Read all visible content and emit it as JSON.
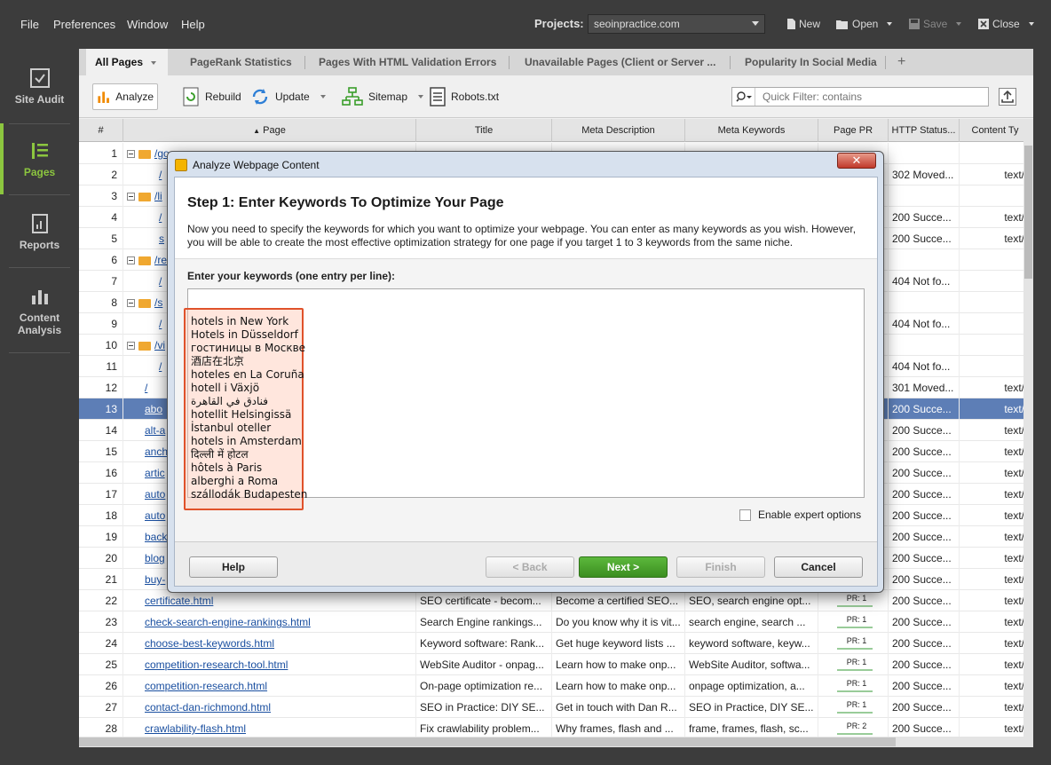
{
  "menubar": {
    "items": [
      "File",
      "Preferences",
      "Window",
      "Help"
    ],
    "projects_label": "Projects:",
    "project_value": "seoinpractice.com",
    "new_label": "New",
    "open_label": "Open",
    "save_label": "Save",
    "close_label": "Close"
  },
  "sidebar": {
    "items": [
      {
        "label": "Site Audit"
      },
      {
        "label": "Pages"
      },
      {
        "label": "Reports"
      },
      {
        "label": "Content",
        "label2": "Analysis"
      }
    ]
  },
  "tabs": [
    "All Pages",
    "PageRank Statistics",
    "Pages With HTML Validation Errors",
    "Unavailable Pages (Client or Server ...",
    "Popularity In Social Media",
    "+"
  ],
  "toolbar": {
    "analyze": "Analyze",
    "rebuild": "Rebuild",
    "update": "Update",
    "sitemap": "Sitemap",
    "robots": "Robots.txt",
    "filter_placeholder": "Quick Filter: contains"
  },
  "table": {
    "headers": [
      "#",
      "Page",
      "Title",
      "Meta Description",
      "Meta Keywords",
      "Page PR",
      "HTTP Status...",
      "Content Ty"
    ],
    "rows": [
      {
        "n": "1",
        "page": "/go",
        "title": "",
        "desc": "",
        "kw": "",
        "pr": "",
        "status": "",
        "ct": "",
        "folder": true
      },
      {
        "n": "2",
        "page": "/",
        "title": "",
        "desc": "",
        "kw": "",
        "pr": "",
        "status": "302 Moved...",
        "ct": "text/"
      },
      {
        "n": "3",
        "page": "/li",
        "title": "",
        "desc": "",
        "kw": "",
        "pr": "",
        "status": "",
        "ct": "",
        "folder": true
      },
      {
        "n": "4",
        "page": "/",
        "title": "",
        "desc": "",
        "kw": "",
        "pr": "",
        "status": "200 Succe...",
        "ct": "text/"
      },
      {
        "n": "5",
        "page": "s",
        "title": "",
        "desc": "",
        "kw": "",
        "pr": "",
        "status": "200 Succe...",
        "ct": "text/"
      },
      {
        "n": "6",
        "page": "/re",
        "title": "",
        "desc": "",
        "kw": "",
        "pr": "",
        "status": "",
        "ct": "",
        "folder": true
      },
      {
        "n": "7",
        "page": "/",
        "title": "",
        "desc": "",
        "kw": "",
        "pr": "",
        "status": "404 Not fo...",
        "ct": ""
      },
      {
        "n": "8",
        "page": "/s",
        "title": "",
        "desc": "",
        "kw": "",
        "pr": "",
        "status": "",
        "ct": "",
        "folder": true
      },
      {
        "n": "9",
        "page": "/",
        "title": "",
        "desc": "",
        "kw": "",
        "pr": "",
        "status": "404 Not fo...",
        "ct": ""
      },
      {
        "n": "10",
        "page": "/vi",
        "title": "",
        "desc": "",
        "kw": "",
        "pr": "",
        "status": "",
        "ct": "",
        "folder": true
      },
      {
        "n": "11",
        "page": "/",
        "title": "",
        "desc": "",
        "kw": "",
        "pr": "",
        "status": "404 Not fo...",
        "ct": ""
      },
      {
        "n": "12",
        "page": "/",
        "title": "",
        "desc": "",
        "kw": "",
        "pr": "",
        "status": "301 Moved...",
        "ct": "text/"
      },
      {
        "n": "13",
        "page": "abo",
        "title": "",
        "desc": "",
        "kw": "",
        "pr": "",
        "status": "200 Succe...",
        "ct": "text/",
        "selected": true
      },
      {
        "n": "14",
        "page": "alt-a",
        "title": "",
        "desc": "",
        "kw": "",
        "pr": "",
        "status": "200 Succe...",
        "ct": "text/"
      },
      {
        "n": "15",
        "page": "anch",
        "title": "",
        "desc": "",
        "kw": "",
        "pr": "",
        "status": "200 Succe...",
        "ct": "text/"
      },
      {
        "n": "16",
        "page": "artic",
        "title": "",
        "desc": "",
        "kw": "",
        "pr": "",
        "status": "200 Succe...",
        "ct": "text/"
      },
      {
        "n": "17",
        "page": "auto",
        "title": "",
        "desc": "",
        "kw": "",
        "pr": "",
        "status": "200 Succe...",
        "ct": "text/"
      },
      {
        "n": "18",
        "page": "auto",
        "title": "",
        "desc": "",
        "kw": "",
        "pr": "",
        "status": "200 Succe...",
        "ct": "text/"
      },
      {
        "n": "19",
        "page": "back",
        "title": "",
        "desc": "",
        "kw": "",
        "pr": "",
        "status": "200 Succe...",
        "ct": "text/"
      },
      {
        "n": "20",
        "page": "blog",
        "title": "",
        "desc": "",
        "kw": "",
        "pr": "",
        "status": "200 Succe...",
        "ct": "text/"
      },
      {
        "n": "21",
        "page": "buy-",
        "title": "",
        "desc": "",
        "kw": "",
        "pr": "",
        "status": "200 Succe...",
        "ct": "text/"
      },
      {
        "n": "22",
        "page": "certificate.html",
        "title": "SEO certificate - becom...",
        "desc": "Become a certified SEO...",
        "kw": "SEO, search engine opt...",
        "pr": "PR: 1",
        "status": "200 Succe...",
        "ct": "text/"
      },
      {
        "n": "23",
        "page": "check-search-engine-rankings.html",
        "title": "Search Engine rankings...",
        "desc": "Do you know why it is vit...",
        "kw": "search engine, search ...",
        "pr": "PR: 1",
        "status": "200 Succe...",
        "ct": "text/"
      },
      {
        "n": "24",
        "page": "choose-best-keywords.html",
        "title": "Keyword software: Rank...",
        "desc": "Get huge keyword lists ...",
        "kw": "keyword software, keyw...",
        "pr": "PR: 1",
        "status": "200 Succe...",
        "ct": "text/"
      },
      {
        "n": "25",
        "page": "competition-research-tool.html",
        "title": "WebSite Auditor - onpag...",
        "desc": "Learn how to make onp...",
        "kw": "WebSite Auditor, softwa...",
        "pr": "PR: 1",
        "status": "200 Succe...",
        "ct": "text/"
      },
      {
        "n": "26",
        "page": "competition-research.html",
        "title": "On-page optimization re...",
        "desc": "Learn how to make onp...",
        "kw": "onpage optimization, a...",
        "pr": "PR: 1",
        "status": "200 Succe...",
        "ct": "text/"
      },
      {
        "n": "27",
        "page": "contact-dan-richmond.html",
        "title": "SEO in Practice: DIY SE...",
        "desc": "Get in touch with Dan R...",
        "kw": "SEO in Practice, DIY SE...",
        "pr": "PR: 1",
        "status": "200 Succe...",
        "ct": "text/"
      },
      {
        "n": "28",
        "page": "crawlability-flash.html",
        "title": "Fix crawlability problem...",
        "desc": "Why frames, flash and ...",
        "kw": "frame, frames, flash, sc...",
        "pr": "PR: 2",
        "status": "200 Succe...",
        "ct": "text/"
      }
    ]
  },
  "dialog": {
    "title": "Analyze Webpage Content",
    "step_title": "Step 1: Enter Keywords To Optimize Your Page",
    "description": "Now you need to specify the keywords for which you want to optimize your webpage. You can enter as many keywords as you wish. However, you will be able to create the most effective optimization strategy for one page if you target 1 to 3 keywords from the same niche.",
    "keywords_label": "Enter your keywords (one entry per line):",
    "keywords": [
      "hotels in New York",
      "Hotels in Düsseldorf",
      "гостиницы в Москве",
      "酒店在北京",
      "hoteles en La Coruña",
      "hotell i Växjö",
      "فنادق في القاهرة",
      "hotellit Helsingissä",
      "İstanbul oteller",
      "hotels in Amsterdam",
      "दिल्ली में होटल",
      "hôtels à Paris",
      "alberghi a Roma",
      "szállodák Budapesten"
    ],
    "expert_label": "Enable expert options",
    "help": "Help",
    "back": "< Back",
    "next": "Next >",
    "finish": "Finish",
    "cancel": "Cancel"
  }
}
